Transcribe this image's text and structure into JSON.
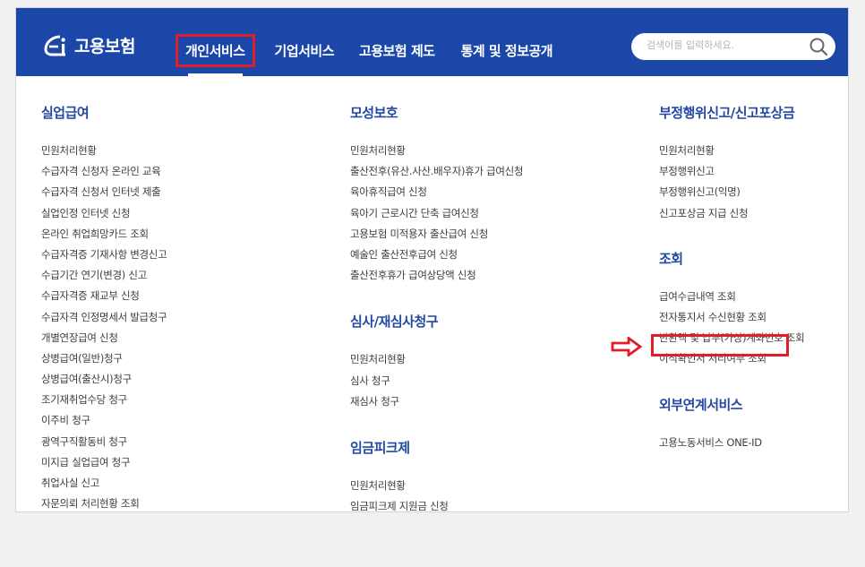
{
  "header": {
    "logo_text": "고용보험",
    "nav": [
      "개인서비스",
      "기업서비스",
      "고용보험 제도",
      "통계 및 정보공개"
    ],
    "search_placeholder": "검색어를 입력하세요."
  },
  "columns": [
    {
      "sections": [
        {
          "title": "실업급여",
          "items": [
            "민원처리현황",
            "수급자격 신청자 온라인 교육",
            "수급자격 신청서 인터넷 제출",
            "실업인정 인터넷 신청",
            "온라인 취업희망카드 조회",
            "수급자격증 기재사항 변경신고",
            "수급기간 연기(변경) 신고",
            "수급자격증 재교부 신청",
            "수급자격 인정명세서 발급청구",
            "개별연장급여 신청",
            "상병급여(일반)청구",
            "상병급여(출산시)청구",
            "조기재취업수당 청구",
            "이주비 청구",
            "광역구직활동비 청구",
            "미지급 실업급여 청구",
            "취업사실 신고",
            "자문의뢰 처리현황 조회"
          ]
        }
      ]
    },
    {
      "sections": [
        {
          "title": "모성보호",
          "items": [
            "민원처리현황",
            "출산전후(유산.사산.배우자)휴가 급여신청",
            "육아휴직급여 신청",
            "육아기 근로시간 단축 급여신청",
            "고용보험 미적용자 출산급여 신청",
            "예술인 출산전후급여 신청",
            "출산전후휴가 급여상당액 신청"
          ]
        },
        {
          "title": "심사/재심사청구",
          "items": [
            "민원처리현황",
            "심사 청구",
            "재심사 청구"
          ]
        },
        {
          "title": "임금피크제",
          "items": [
            "민원처리현황",
            "임금피크제 지원금 신청"
          ]
        }
      ]
    },
    {
      "sections": [
        {
          "title": "부정행위신고/신고포상금",
          "items": [
            "민원처리현황",
            "부정행위신고",
            "부정행위신고(익명)",
            "신고포상금 지급 신청"
          ]
        },
        {
          "title": "조회",
          "items": [
            "급여수급내역 조회",
            "전자통지서 수신현황 조회",
            "반환액 및 납부(가상)계좌번호 조회",
            "이직확인서 처리여부 조회"
          ]
        },
        {
          "title": "외부연계서비스",
          "items": [
            "고용노동서비스 ONE-ID"
          ]
        }
      ]
    }
  ],
  "colors": {
    "header_bg": "#1a47a8",
    "section_title": "#2349a4",
    "highlight": "#e21d2a"
  }
}
